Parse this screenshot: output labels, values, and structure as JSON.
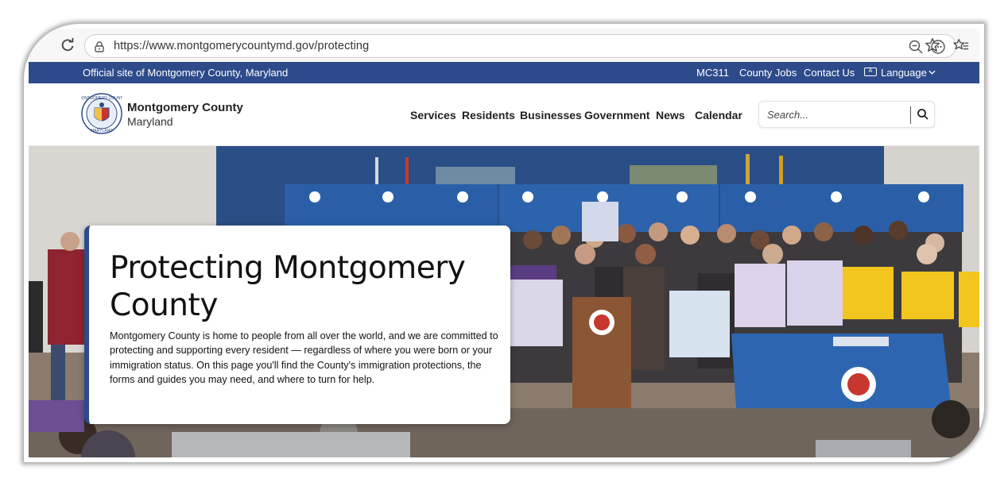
{
  "browser": {
    "url": "https://www.montgomerycountymd.gov/protecting"
  },
  "utility_bar": {
    "official_text": "Official site of Montgomery County, Maryland",
    "links": [
      "MC311",
      "County Jobs",
      "Contact Us"
    ],
    "language_label": "Language"
  },
  "header": {
    "brand_name": "Montgomery County",
    "brand_sub": "Maryland",
    "nav": [
      "Services",
      "Residents",
      "Businesses",
      "Government",
      "News",
      "Calendar"
    ],
    "search_placeholder": "Search..."
  },
  "hero": {
    "title": "Protecting Montgomery County",
    "body": "Montgomery County is home to people from all over the world, and we are committed to protecting and supporting every resident — regardless of where you were born or your immigration status. On this page you'll find the County's immigration protections, the forms and guides you may need, and where to turn for help."
  },
  "colors": {
    "brand_blue": "#2d4a8a",
    "backdrop_blue": "#2a5fa8"
  }
}
